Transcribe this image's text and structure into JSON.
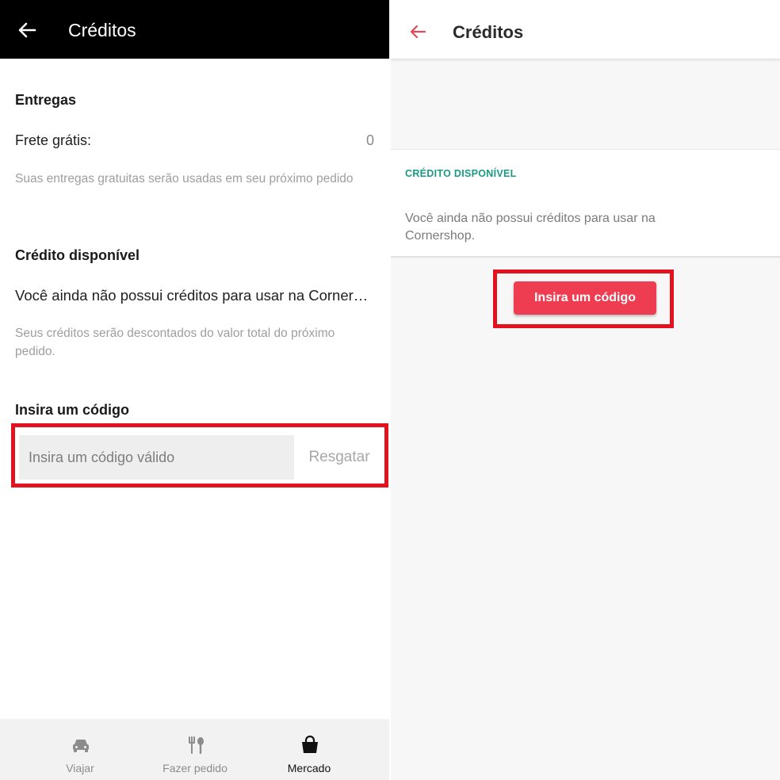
{
  "left": {
    "header": {
      "title": "Créditos",
      "back_icon": "arrow-left-icon"
    },
    "deliveries": {
      "heading": "Entregas",
      "free_shipping_label": "Frete grátis:",
      "free_shipping_value": "0",
      "hint": "Suas entregas gratuitas serão usadas em seu próximo pedido"
    },
    "credit": {
      "heading": "Crédito disponível",
      "message": "Você ainda não possui créditos para usar na Cornershop.",
      "hint": "Seus créditos serão descontados do valor total do próximo pedido."
    },
    "code": {
      "heading": "Insira um código",
      "placeholder": "Insira um código válido",
      "redeem_label": "Resgatar"
    },
    "bottom_nav": [
      {
        "label": "Viajar",
        "icon": "car-icon",
        "active": false
      },
      {
        "label": "Fazer pedido",
        "icon": "utensils-icon",
        "active": false
      },
      {
        "label": "Mercado",
        "icon": "shopping-bag-icon",
        "active": true
      }
    ],
    "colors": {
      "header_bg": "#000000",
      "highlight": "#e3121f"
    }
  },
  "right": {
    "header": {
      "title": "Créditos",
      "back_icon": "arrow-left-icon"
    },
    "card": {
      "caption": "CRÉDITO DISPONÍVEL",
      "message": "Você ainda não possui créditos para usar na Cornershop."
    },
    "button_label": "Insira um código",
    "colors": {
      "accent": "#ee3d51",
      "caption": "#1a9a84",
      "highlight": "#e3121f"
    }
  }
}
